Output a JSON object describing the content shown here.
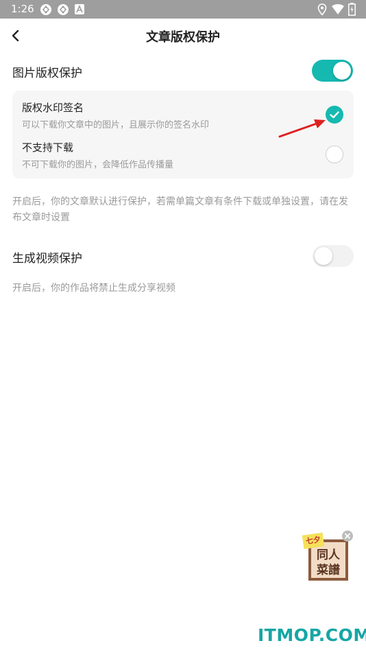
{
  "status_bar": {
    "time": "1:26"
  },
  "nav": {
    "title": "文章版权保护"
  },
  "image_protection": {
    "label": "图片版权保护",
    "enabled": true,
    "options": [
      {
        "title": "版权水印签名",
        "description": "可以下载你文章中的图片，且展示你的签名水印",
        "selected": true
      },
      {
        "title": "不支持下载",
        "description": "不可下载你的图片，会降低作品传播量",
        "selected": false
      }
    ],
    "note": "开启后，你的文章默认进行保护，若需单篇文章有条件下载或单独设置，请在发布文章时设置"
  },
  "video_protection": {
    "label": "生成视频保护",
    "enabled": false,
    "note": "开启后，你的作品将禁止生成分享视频"
  },
  "ad": {
    "text_top": "七夕",
    "text_main_1": "同人",
    "text_main_2": "菜譜"
  },
  "watermark": {
    "text": "ITMOP.COM"
  },
  "colors": {
    "accent": "#15b9b0",
    "status_bar": "#9e9e9e",
    "arrow": "#e02020"
  }
}
